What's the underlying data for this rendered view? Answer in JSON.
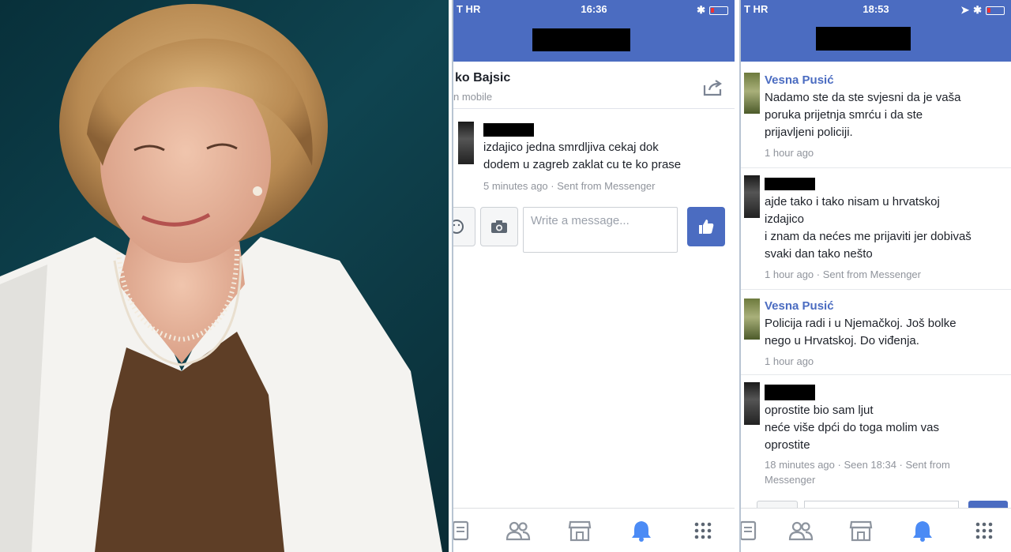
{
  "left_photo": {
    "description_icon": "portrait-photo"
  },
  "phone_a": {
    "status": {
      "carrier": "T HR",
      "time": "16:36"
    },
    "header": {
      "name": "ko Bajsic",
      "subtitle": "n mobile"
    },
    "messages": [
      {
        "text": "izdajico jedna smrdljiva cekaj dok\ndodem u zagreb zaklat cu te ko prase",
        "meta": "5 minutes ago · Sent from Messenger"
      }
    ],
    "composer": {
      "placeholder": "Write a message..."
    }
  },
  "phone_b": {
    "status": {
      "carrier": "T HR",
      "time": "18:53"
    },
    "messages": [
      {
        "sender": "Vesna Pusić",
        "text": "Nadamo ste da ste svjesni da je vaša\nporuka prijetnja smrću i da ste\nprijavljeni policiji.",
        "meta": "1 hour ago"
      },
      {
        "text": "ajde tako i tako nisam u hrvatskoj\nizdajico\ni znam da nećes me prijaviti jer dobivaš\nsvaki dan tako nešto",
        "meta": "1 hour ago · Sent from Messenger"
      },
      {
        "sender": "Vesna Pusić",
        "text": "Policija radi i u Njemačkoj. Još bolke\nnego u Hrvatskoj. Do viđenja.",
        "meta": "1 hour ago"
      },
      {
        "text": "oprostite bio sam ljut\nneće više dpći do toga molim vas\noprostite",
        "meta": "18 minutes ago · Seen 18:34 · Sent from\nMessenger"
      }
    ]
  },
  "colors": {
    "fb_blue": "#4b6cc1",
    "text": "#1d2129",
    "meta": "#90949c"
  }
}
